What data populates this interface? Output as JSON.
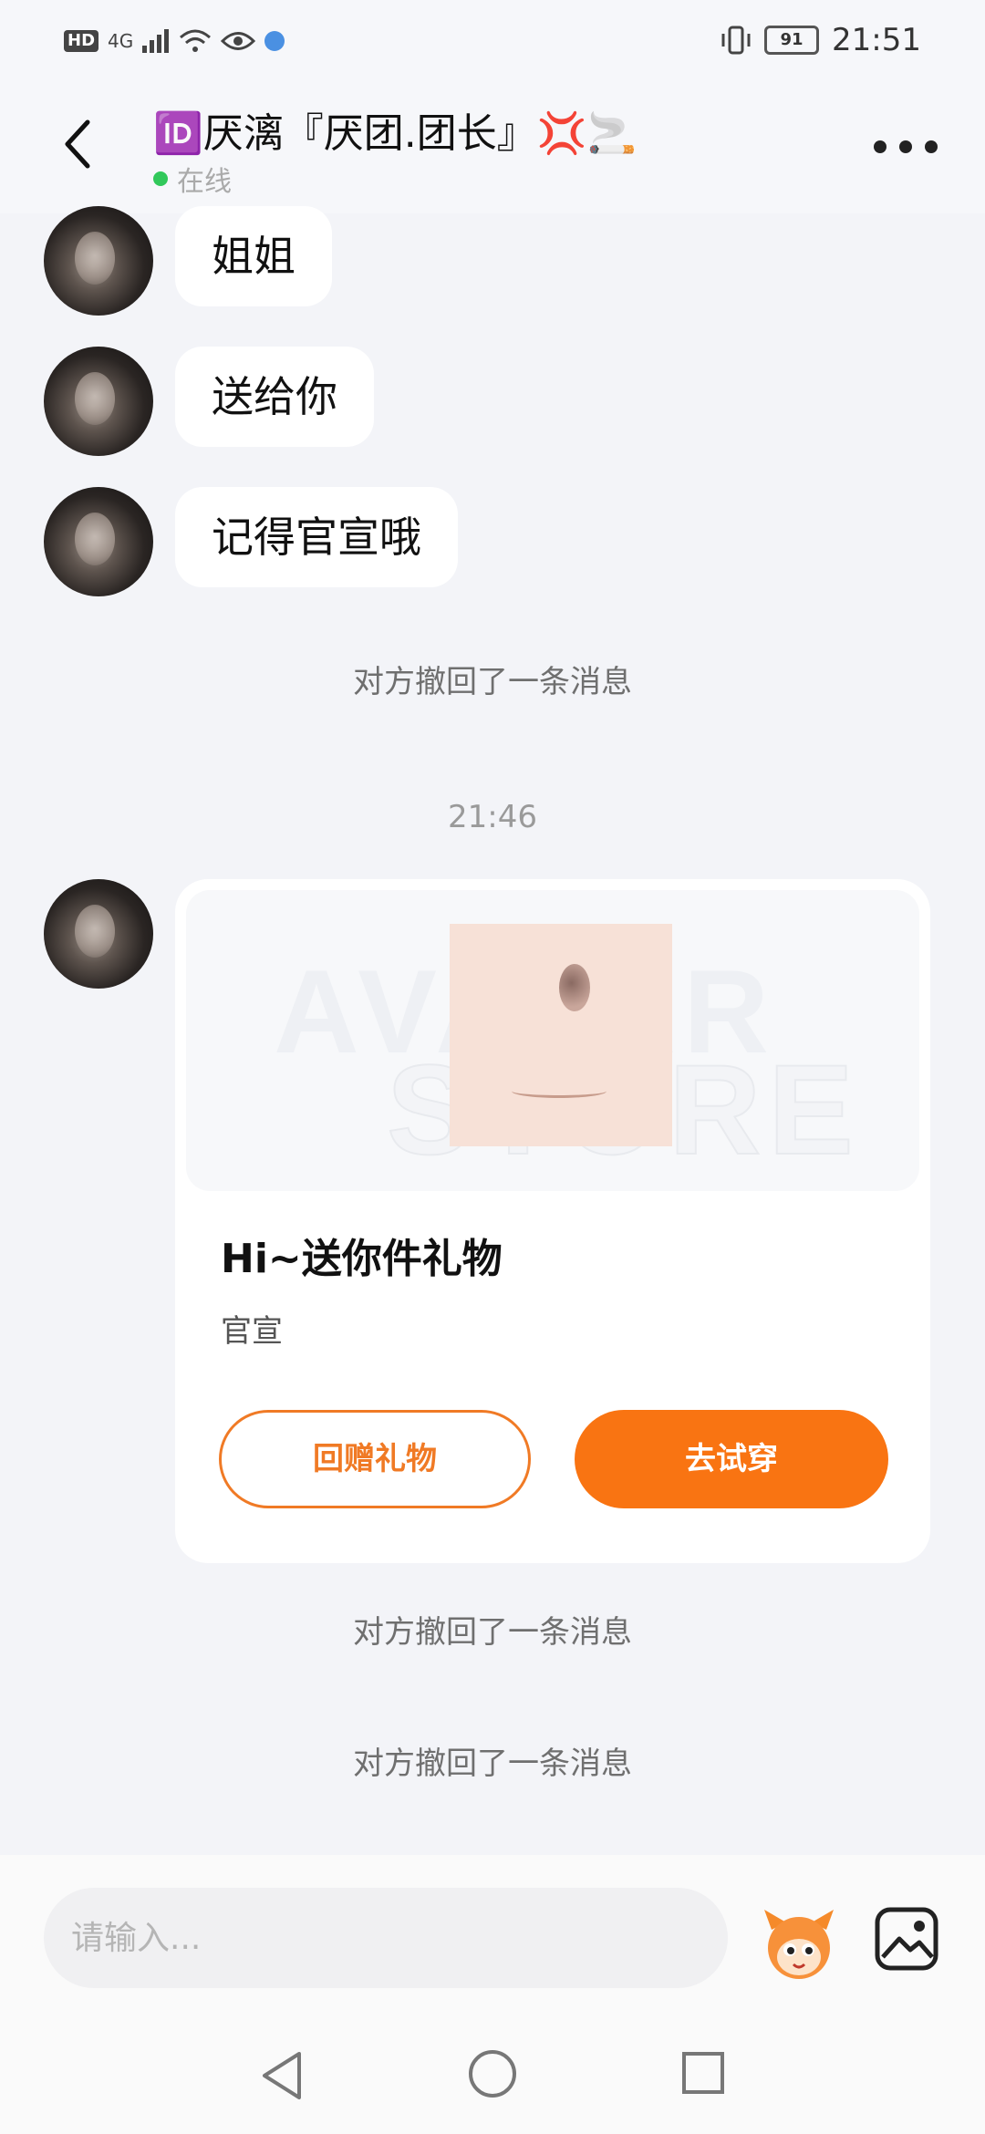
{
  "status_bar": {
    "network": "HD",
    "signal": "4G",
    "battery": "91",
    "time": "21:51"
  },
  "header": {
    "title": "🆔厌漓『厌团.团长』💢🚬",
    "status": "在线"
  },
  "messages": [
    {
      "text": "姐姐"
    },
    {
      "text": "送给你"
    },
    {
      "text": "记得官宣哦"
    }
  ],
  "system_notices": [
    "对方撤回了一条消息",
    "对方撤回了一条消息",
    "对方撤回了一条消息"
  ],
  "timestamp": "21:46",
  "gift_card": {
    "watermark_line1": "AVATAR",
    "watermark_line2": "STORE",
    "title": "Hi~送你件礼物",
    "subtitle": "官宣",
    "return_gift_label": "回赠礼物",
    "try_on_label": "去试穿",
    "accent_color": "#f97412"
  },
  "input": {
    "placeholder": "请输入..."
  },
  "icons": {
    "back": "chevron-left-icon",
    "more": "more-dots-icon",
    "emoji": "mascot-emoji-icon",
    "image": "image-gallery-icon"
  }
}
